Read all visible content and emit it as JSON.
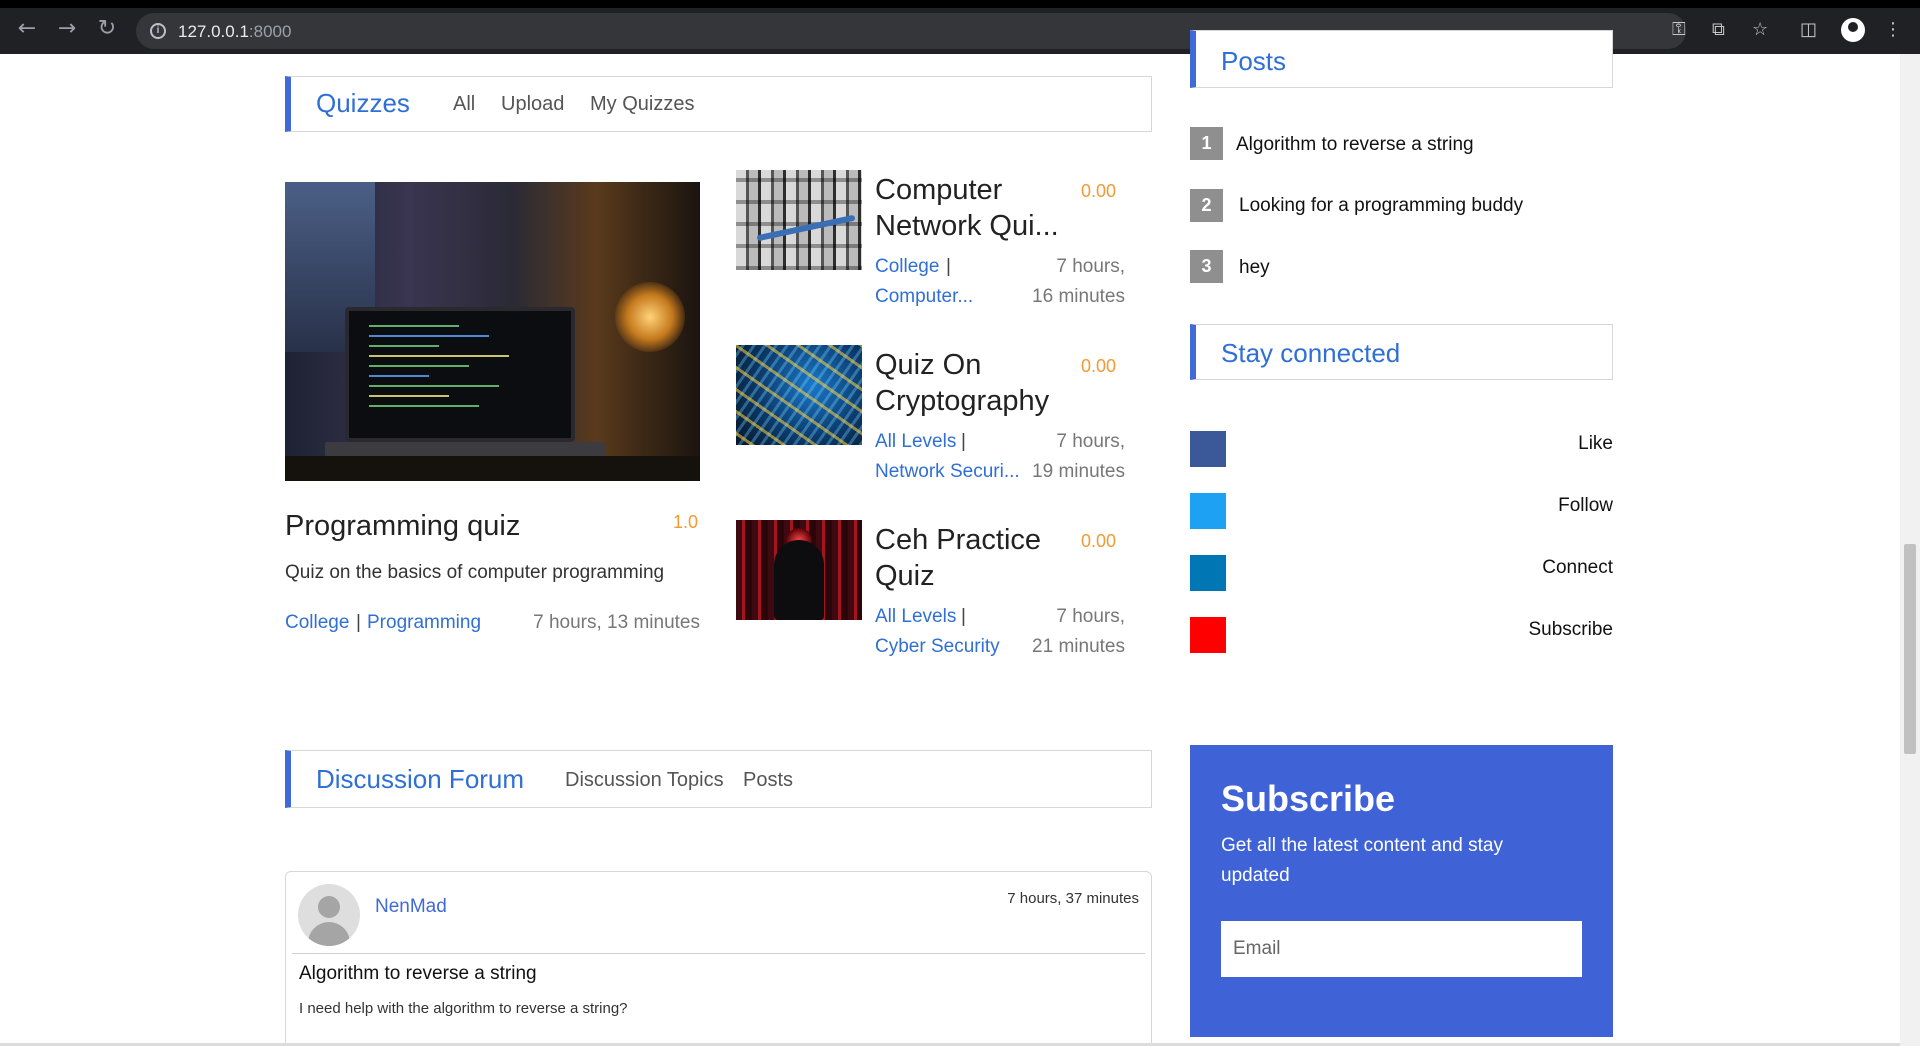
{
  "browser": {
    "url_host": "127.0.0.1",
    "url_port": ":8000"
  },
  "quizzes_section": {
    "title": "Quizzes",
    "links": [
      "All",
      "Upload",
      "My Quizzes"
    ]
  },
  "featured_quiz": {
    "title": "Programming quiz",
    "rating": "1.0",
    "description": "Quiz on the basics of computer programming",
    "category": "College",
    "separator": "|",
    "subject": "Programming",
    "time": "7 hours, 13 minutes"
  },
  "quiz_list": [
    {
      "title_line1": "Computer",
      "title_line2": "Network Qui...",
      "rating": "0.00",
      "category": "College",
      "separator": "|",
      "subject": "Computer...",
      "time_line1": "7 hours,",
      "time_line2": "16 minutes"
    },
    {
      "title_line1": "Quiz On",
      "title_line2": "Cryptography",
      "rating": "0.00",
      "category": "All Levels",
      "separator": "|",
      "subject": "Network Securi...",
      "time_line1": "7 hours,",
      "time_line2": "19 minutes"
    },
    {
      "title_line1": "Ceh Practice",
      "title_line2": "Quiz",
      "rating": "0.00",
      "category": "All Levels",
      "separator": "|",
      "subject": "Cyber Security",
      "time_line1": "7 hours,",
      "time_line2": "21 minutes"
    }
  ],
  "forum_section": {
    "title": "Discussion Forum",
    "links": [
      "Discussion Topics",
      "Posts"
    ]
  },
  "forum_post": {
    "username": "NenMad",
    "time": "7 hours, 37 minutes",
    "title": "Algorithm to reverse a string",
    "body": "I need help with the algorithm to reverse a string?"
  },
  "sidebar": {
    "posts_header": "Posts",
    "popular_posts": [
      {
        "num": "1",
        "title": "Algorithm to reverse a string"
      },
      {
        "num": "2",
        "title": "Looking for a programming buddy"
      },
      {
        "num": "3",
        "title": "hey"
      }
    ],
    "stay_connected_title": "Stay connected",
    "social": [
      {
        "label": "Like",
        "color": "#3b5998"
      },
      {
        "label": "Follow",
        "color": "#1da1f2"
      },
      {
        "label": "Connect",
        "color": "#0077b5"
      },
      {
        "label": "Subscribe",
        "color": "#ff0000"
      }
    ],
    "subscribe": {
      "title": "Subscribe",
      "subtitle": "Get all the latest content and stay updated",
      "email_placeholder": "Email",
      "accent_color": "#3f63d6"
    }
  }
}
